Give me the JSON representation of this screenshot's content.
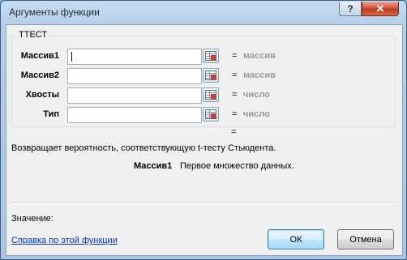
{
  "window": {
    "title": "Аргументы функции",
    "help_button": "?",
    "close_button": "✕"
  },
  "function_group": {
    "name": "ТТЕСТ",
    "args": [
      {
        "label": "Массив1",
        "value": "",
        "equals": "=",
        "type_hint": "массив"
      },
      {
        "label": "Массив2",
        "value": "",
        "equals": "=",
        "type_hint": "массив"
      },
      {
        "label": "Хвосты",
        "value": "",
        "equals": "=",
        "type_hint": "число"
      },
      {
        "label": "Тип",
        "value": "",
        "equals": "=",
        "type_hint": "число"
      }
    ]
  },
  "result_equals": "=",
  "description": "Возвращает вероятность, соответствующую t-тесту Стьюдента.",
  "arg_help": {
    "name": "Массив1",
    "text": "Первое множество данных."
  },
  "value_label": "Значение:",
  "help_link": "Справка по этой функции",
  "buttons": {
    "ok": "ОК",
    "cancel": "Отмена"
  }
}
